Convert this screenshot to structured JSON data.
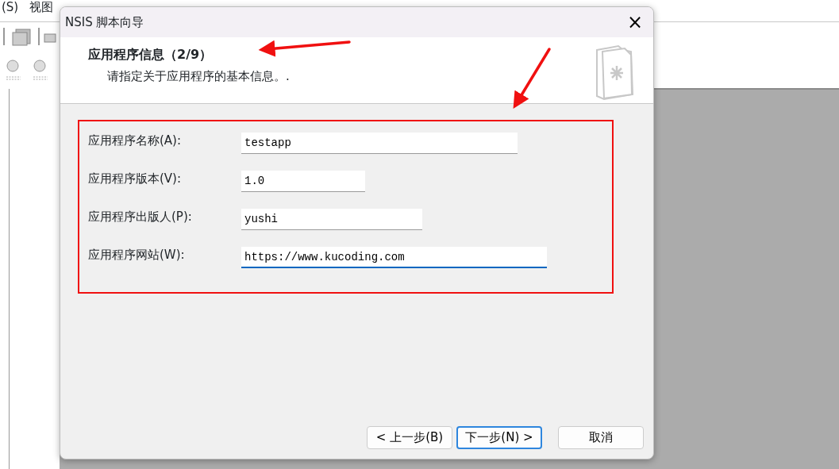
{
  "app": {
    "menu": [
      "(S)",
      "视图"
    ]
  },
  "dialog": {
    "title": "NSIS 脚本向导",
    "close": "×",
    "header": {
      "title": "应用程序信息（2/9）",
      "subtitle": "请指定关于应用程序的基本信息。."
    },
    "fields": [
      {
        "label": "应用程序名称(A):",
        "value": "testapp",
        "focused": false
      },
      {
        "label": "应用程序版本(V):",
        "value": "1.0",
        "focused": false
      },
      {
        "label": "应用程序出版人(P):",
        "value": "yushi",
        "focused": false
      },
      {
        "label": "应用程序网站(W):",
        "value": "https://www.kucoding.com",
        "focused": true
      }
    ],
    "buttons": [
      {
        "label": "< 上一步(B)",
        "focused": false
      },
      {
        "label": "下一步(N) >",
        "focused": true
      },
      {
        "label": "取消",
        "focused": false
      }
    ]
  }
}
